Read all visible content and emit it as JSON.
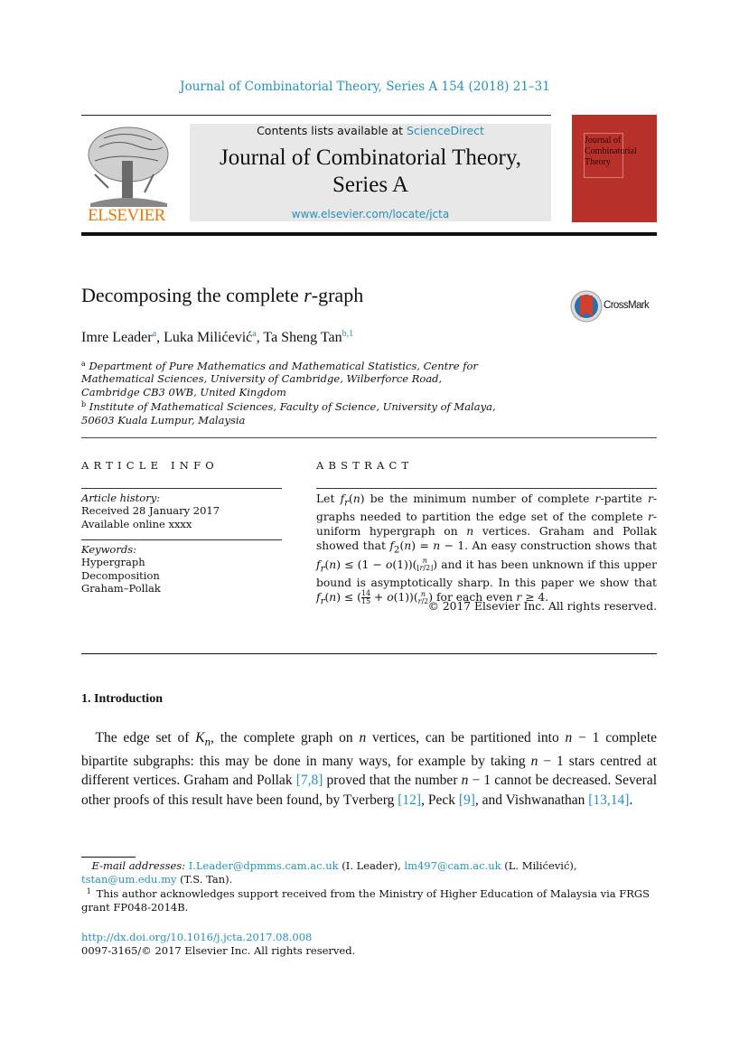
{
  "running_head": "Journal of Combinatorial Theory, Series A 154 (2018) 21–31",
  "masthead": {
    "publisher": "ELSEVIER",
    "contents_prefix": "Contents lists available at ",
    "contents_link": "ScienceDirect",
    "journal_title_line1": "Journal of Combinatorial Theory,",
    "journal_title_line2": "Series A",
    "journal_url": "www.elsevier.com/locate/jcta",
    "cover_lines": [
      "Journal of",
      "Combinatorial",
      "Theory"
    ],
    "cover_color": "#b8302a",
    "link_color": "#2a8fb8",
    "publisher_color": "#e07a10"
  },
  "article": {
    "title_prefix": "Decomposing the complete ",
    "title_var": "r",
    "title_suffix": "-graph",
    "crossmark": "CrossMark",
    "authors": [
      {
        "name": "Imre Leader",
        "sup": "a",
        "sep": ", "
      },
      {
        "name": "Luka Milićević",
        "sup": "a",
        "sep": ", "
      },
      {
        "name": "Ta Sheng Tan",
        "sup": "b,1",
        "sep": ""
      }
    ],
    "affiliations": [
      {
        "key": "a",
        "lines": [
          "Department of Pure Mathematics and Mathematical Statistics, Centre for",
          "Mathematical Sciences, University of Cambridge, Wilberforce Road,",
          "Cambridge CB3 0WB, United Kingdom"
        ]
      },
      {
        "key": "b",
        "lines": [
          "Institute of Mathematical Sciences, Faculty of Science, University of Malaya,",
          "50603 Kuala Lumpur, Malaysia"
        ]
      }
    ]
  },
  "article_info": {
    "heading": "ARTICLE INFO",
    "history_label": "Article history:",
    "received": "Received 28 January 2017",
    "available": "Available online xxxx",
    "keywords_label": "Keywords:",
    "keywords": [
      "Hypergraph",
      "Decomposition",
      "Graham–Pollak"
    ]
  },
  "abstract": {
    "heading": "ABSTRACT",
    "s1a": "Let ",
    "f_r_n": "f",
    "s1b": " be the minimum number of complete ",
    "s1c": "-partite ",
    "s1d": "-graphs needed to partition the edge set of the complete ",
    "s1e": "-uniform hypergraph on ",
    "s1f": " vertices. Graham and Pollak showed that ",
    "s2": " An easy construction shows that ",
    "s3": " and it has been unknown if this upper bound is asymptotically sharp. In this paper we show that ",
    "s4": " for each even ",
    "s5": ".",
    "frac_num": "14",
    "frac_den": "15",
    "copyright": "© 2017 Elsevier Inc. All rights reserved."
  },
  "introduction": {
    "heading": "1. Introduction",
    "p1_a": "The edge set of ",
    "p1_b": ", the complete graph on ",
    "p1_c": " vertices, can be partitioned into ",
    "p1_d": " complete bipartite subgraphs: this may be done in many ways, for example by taking ",
    "p1_e": " stars centred at different vertices. Graham and Pollak ",
    "ref_78": "[7,8]",
    "p1_f": " proved that the number ",
    "p1_g": " cannot be decreased. Several other proofs of this result have been found, by Tverberg ",
    "ref_12": "[12]",
    "p1_h": ", Peck ",
    "ref_9": "[9]",
    "p1_i": ", and Vishwanathan ",
    "ref_1314": "[13,14]",
    "p1_j": "."
  },
  "footnotes": {
    "email_label": "E-mail addresses:",
    "emails": [
      {
        "addr": "I.Leader@dpmms.cam.ac.uk",
        "who": " (I. Leader), "
      },
      {
        "addr": "lm497@cam.ac.uk",
        "who": " (L. Milićević), "
      },
      {
        "addr": "tstan@um.edu.my",
        "who": " (T.S. Tan)."
      }
    ],
    "fn1_mark": "1",
    "fn1_text": "This author acknowledges support received from the Ministry of Higher Education of Malaysia via FRGS grant FP048-2014B."
  },
  "doi": {
    "url": "http://dx.doi.org/10.1016/j.jcta.2017.08.008",
    "issn_line": "0097-3165/© 2017 Elsevier Inc. All rights reserved."
  }
}
